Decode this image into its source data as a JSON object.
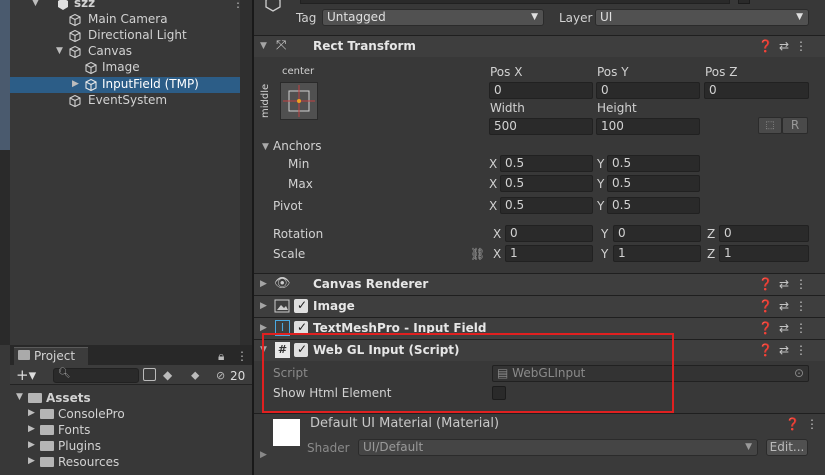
{
  "hierarchy": {
    "root": "szz",
    "items": [
      {
        "label": "Main Camera"
      },
      {
        "label": "Directional Light"
      },
      {
        "label": "Canvas"
      },
      {
        "label": "Image"
      },
      {
        "label": "InputField (TMP)"
      },
      {
        "label": "EventSystem"
      }
    ]
  },
  "project": {
    "tab_label": "Project",
    "hidden_count": "20",
    "root": "Assets",
    "folders": [
      "ConsolePro",
      "Fonts",
      "Plugins",
      "Resources"
    ]
  },
  "inspector": {
    "tag_label": "Tag",
    "tag_value": "Untagged",
    "layer_label": "Layer",
    "layer_value": "UI",
    "rect_transform": {
      "title": "Rect Transform",
      "anchor_h": "center",
      "anchor_v": "middle",
      "pos_x_label": "Pos X",
      "pos_y_label": "Pos Y",
      "pos_z_label": "Pos Z",
      "pos_x": "0",
      "pos_y": "0",
      "pos_z": "0",
      "width_label": "Width",
      "height_label": "Height",
      "width": "500",
      "height": "100",
      "r_button": "R",
      "anchors_label": "Anchors",
      "min_label": "Min",
      "max_label": "Max",
      "pivot_label": "Pivot",
      "x_label": "X",
      "y_label": "Y",
      "z_label": "Z",
      "min_x": "0.5",
      "min_y": "0.5",
      "max_x": "0.5",
      "max_y": "0.5",
      "pivot_x": "0.5",
      "pivot_y": "0.5",
      "rotation_label": "Rotation",
      "rot_x": "0",
      "rot_y": "0",
      "rot_z": "0",
      "scale_label": "Scale",
      "scale_x": "1",
      "scale_y": "1",
      "scale_z": "1"
    },
    "components": [
      {
        "title": "Canvas Renderer"
      },
      {
        "title": "Image"
      },
      {
        "title": "TextMeshPro - Input Field"
      },
      {
        "title": "Web GL Input (Script)"
      }
    ],
    "webgl": {
      "script_label": "Script",
      "script_value": "WebGLInput",
      "show_html_label": "Show Html Element"
    },
    "material": {
      "title": "Default UI Material (Material)",
      "shader_label": "Shader",
      "shader_value": "UI/Default",
      "edit_button": "Edit..."
    }
  },
  "colors": {
    "selection": "#2c5d87",
    "highlight_box": "#e02020",
    "anchor_dot": "#f0a020"
  }
}
